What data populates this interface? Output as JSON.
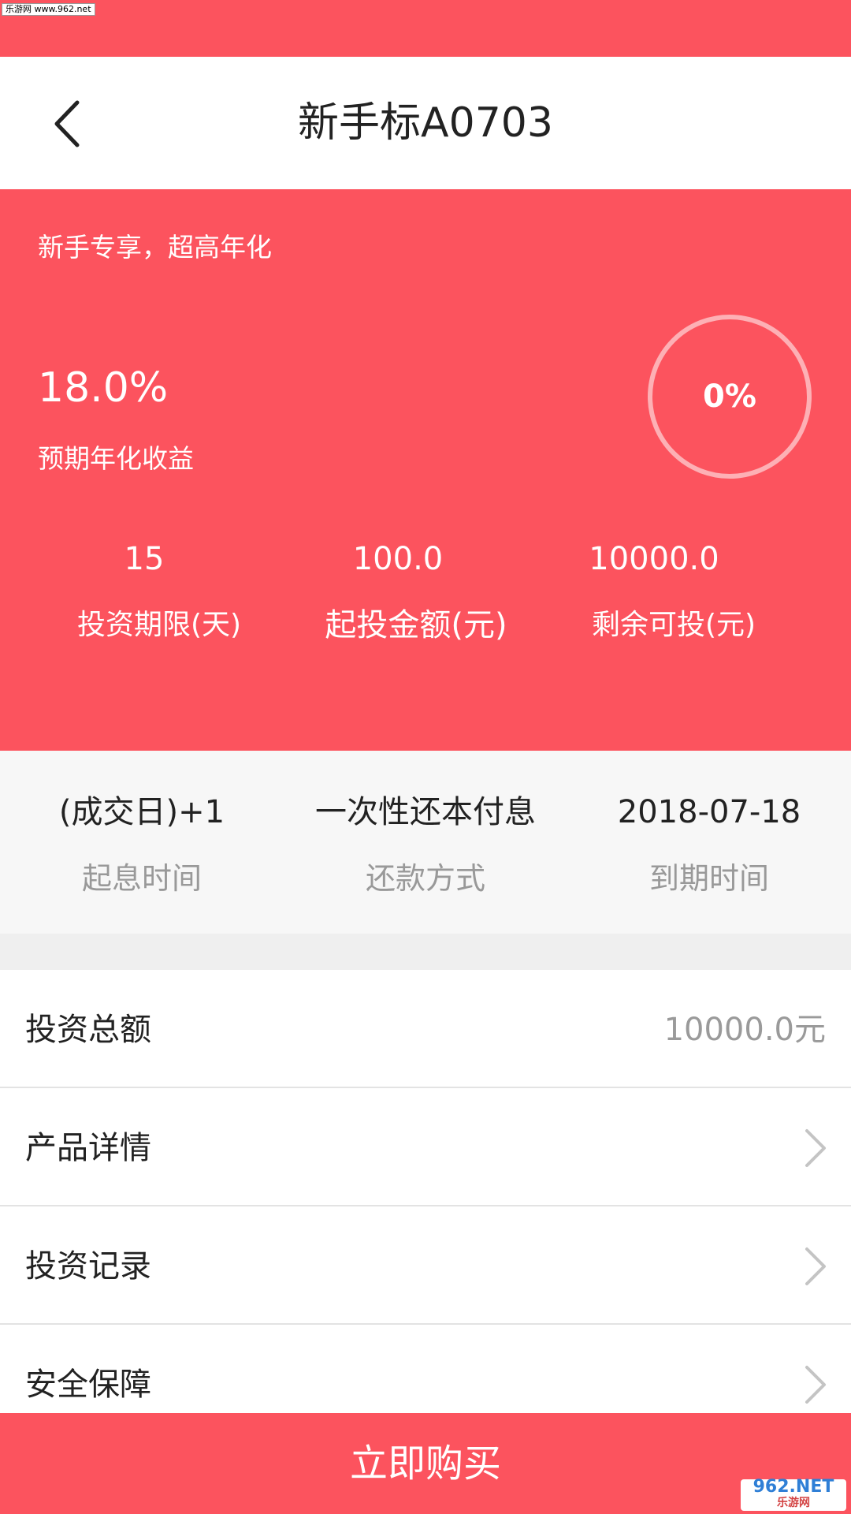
{
  "watermark": {
    "top_left": "乐游网 www.962.net",
    "bottom_right_main": "962.NET",
    "bottom_right_sub": "乐游网"
  },
  "header": {
    "title": "新手标A0703"
  },
  "hero": {
    "tagline": "新手专享，超高年化",
    "rate_value": "18.0%",
    "rate_label": "预期年化收益",
    "progress_text": "0%",
    "progress_fraction": 0,
    "stats": [
      {
        "value": "15",
        "label": "投资期限(天)"
      },
      {
        "value": "100.0",
        "label": "起投金额(元)"
      },
      {
        "value": "10000.0",
        "label": "剩余可投(元)"
      }
    ]
  },
  "terms": [
    {
      "value": "(成交日)+1",
      "label": "起息时间"
    },
    {
      "value": "一次性还本付息",
      "label": "还款方式"
    },
    {
      "value": "2018-07-18",
      "label": "到期时间"
    }
  ],
  "list": {
    "total": {
      "label": "投资总额",
      "value": "10000.0元"
    },
    "items": [
      {
        "label": "产品详情"
      },
      {
        "label": "投资记录"
      },
      {
        "label": "安全保障"
      }
    ]
  },
  "buy_button": {
    "label": "立即购买"
  },
  "colors": {
    "brand": "#fc535e",
    "ring": "#fdb0b5"
  },
  "icons": {
    "back": "chevron-left-icon",
    "row_arrow": "chevron-right-icon"
  }
}
